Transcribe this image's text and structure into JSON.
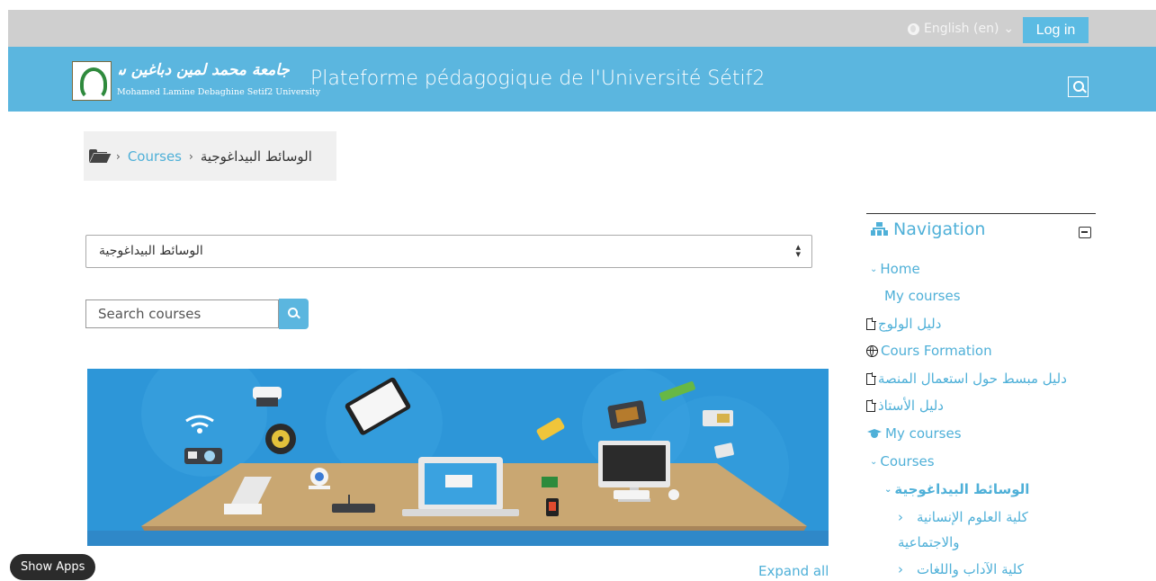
{
  "topbar": {
    "language": "English (en)",
    "language_caret": "⌄",
    "login_label": "Log in"
  },
  "header": {
    "logo_arabic": "جامعة محمد لمين دباغين سطيف٢",
    "logo_latin": "Mohamed Lamine Debaghine Setif2 University",
    "site_title": "Plateforme pédagogique de l'Université Sétif2"
  },
  "breadcrumb": {
    "sep": "›",
    "courses": "Courses",
    "current": "الوسائط البيداغوجية"
  },
  "category_select": {
    "value": "الوسائط البيداغوجية"
  },
  "search": {
    "placeholder": "Search courses"
  },
  "expand_all": "Expand all",
  "show_apps": "Show Apps",
  "navigation": {
    "title": "Navigation",
    "items": [
      {
        "label": "Home",
        "chev": "⌄"
      },
      {
        "label": "My courses"
      },
      {
        "label": "دليل الولوج"
      },
      {
        "label": "Cours Formation"
      },
      {
        "label": "دليل مبسط حول استعمال المنصة"
      },
      {
        "label": "دليل الأستاذ"
      },
      {
        "label": "My courses"
      },
      {
        "label": "Courses",
        "chev": "⌄"
      },
      {
        "label": "الوسائط البيداغوجية",
        "chev": "⌄"
      },
      {
        "label": "كلية العلوم الإنسانية",
        "chev": "‹"
      },
      {
        "label": "والاجتماعية"
      },
      {
        "label": "كلية الآداب واللغات",
        "chev": "‹"
      }
    ]
  },
  "colors": {
    "accent": "#5bb6df",
    "link": "#4fb0d8",
    "topbar": "#cfcfcf"
  }
}
